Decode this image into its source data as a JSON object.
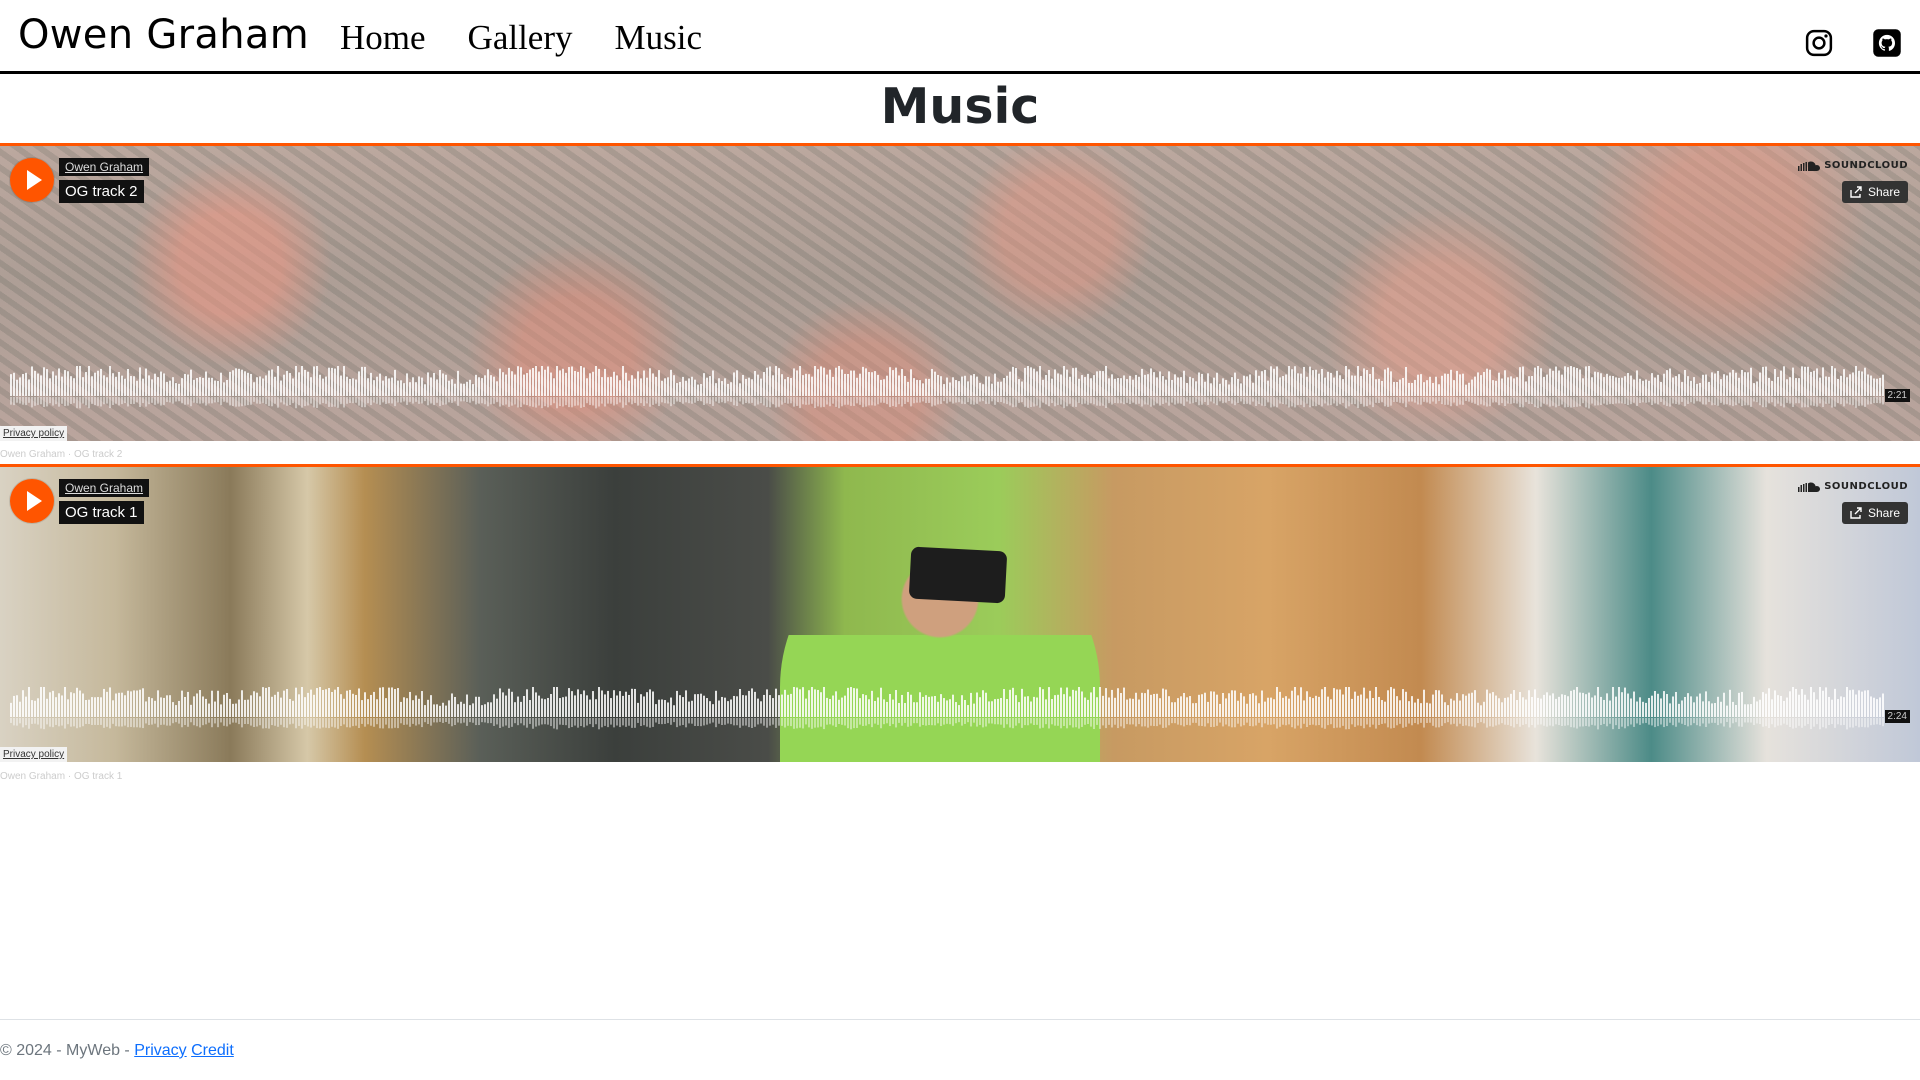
{
  "header": {
    "brand": "Owen Graham",
    "nav": [
      "Home",
      "Gallery",
      "Music"
    ],
    "social": [
      {
        "icon": "instagram-icon"
      },
      {
        "icon": "github-icon"
      }
    ]
  },
  "page": {
    "title": "Music"
  },
  "players": [
    {
      "artist": "Owen Graham",
      "track": "OG track 2",
      "brand": "SOUNDCLOUD",
      "share": "Share",
      "duration": "2:21",
      "privacy": "Privacy policy",
      "caption_artist": "Owen Graham",
      "caption_sep": "·",
      "caption_track": "OG track 2"
    },
    {
      "artist": "Owen Graham",
      "track": "OG track 1",
      "brand": "SOUNDCLOUD",
      "share": "Share",
      "duration": "2:24",
      "privacy": "Privacy policy",
      "caption_artist": "Owen Graham",
      "caption_sep": "·",
      "caption_track": "OG track 1"
    }
  ],
  "footer": {
    "text": "© 2024 - MyWeb -",
    "links": [
      "Privacy",
      "Credit"
    ]
  },
  "colors": {
    "accent": "#ff5500",
    "link": "#0d6efd"
  }
}
